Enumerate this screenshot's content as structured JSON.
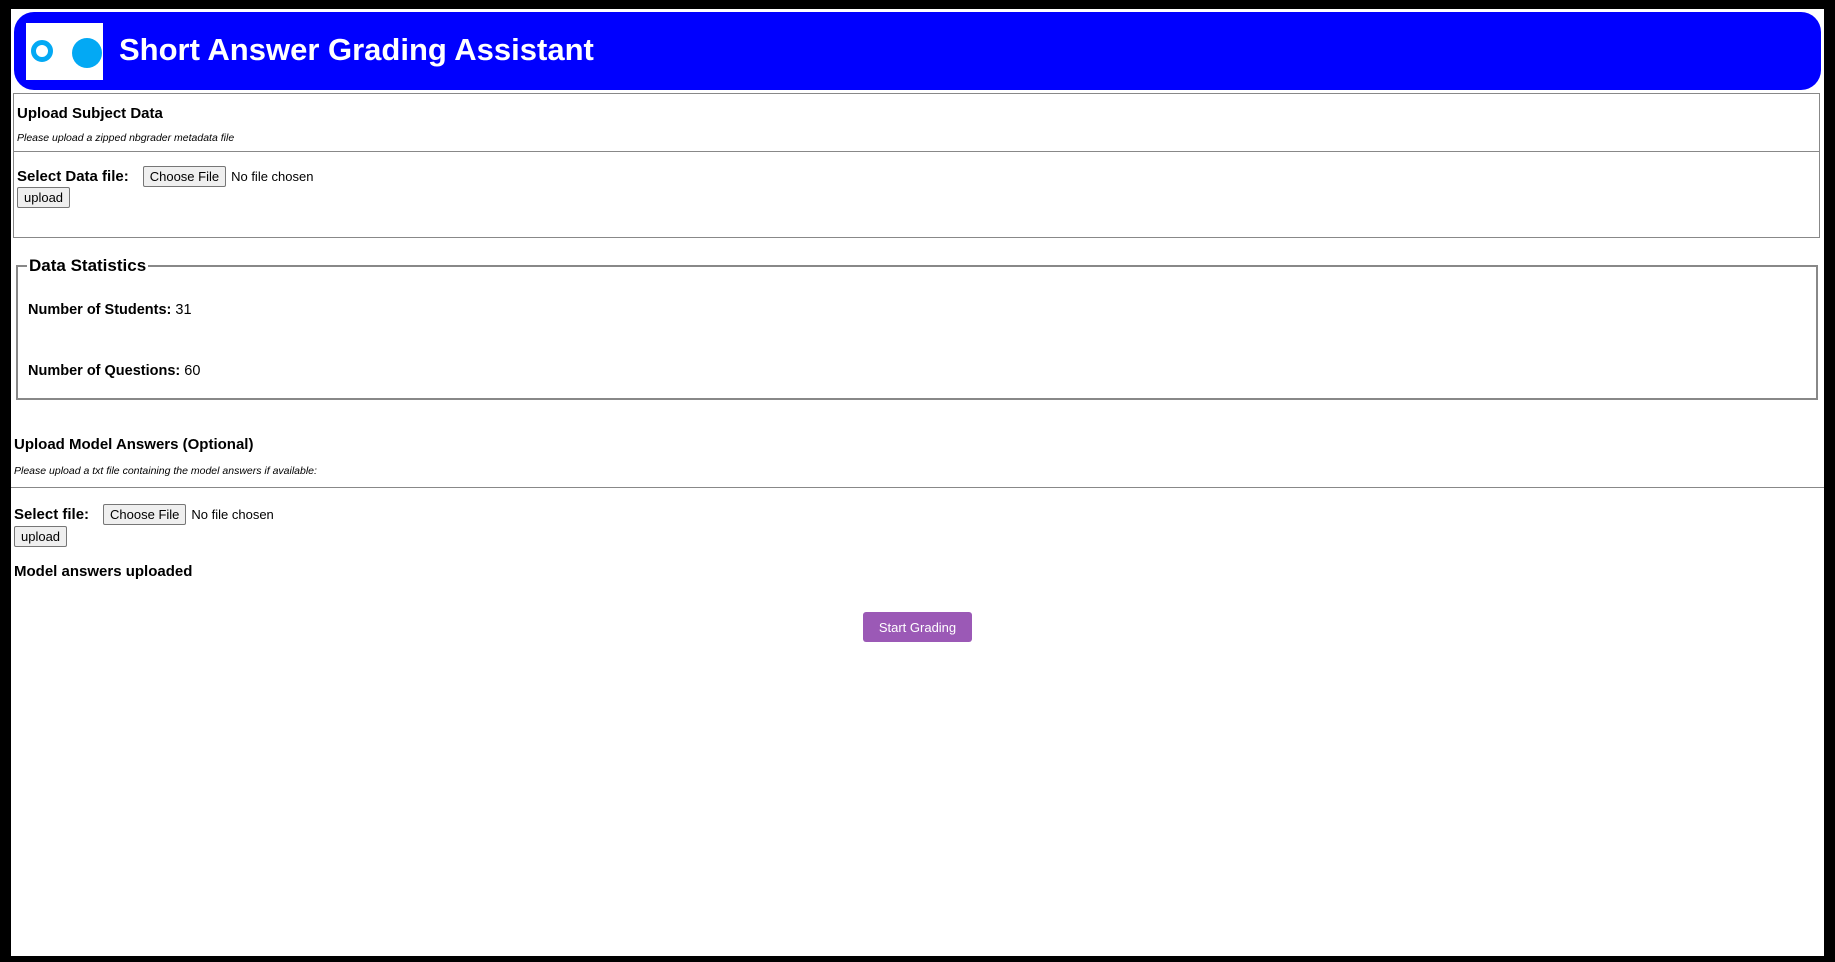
{
  "header": {
    "title": "Short Answer Grading Assistant",
    "logo_icon": "two-circles-logo",
    "background_color": "#0000ff",
    "logo_color": "#03a9f4"
  },
  "subject_upload": {
    "title": "Upload Subject Data",
    "description": "Please upload a zipped nbgrader metadata file",
    "file_label": "Select Data file:",
    "choose_button": "Choose File",
    "file_status": "No file chosen",
    "upload_button": "upload"
  },
  "stats": {
    "legend": "Data Statistics",
    "students_label": "Number of Students:",
    "students_value": "31",
    "questions_label": "Number of Questions:",
    "questions_value": "60"
  },
  "model_upload": {
    "title": "Upload Model Answers (Optional)",
    "description": "Please upload a txt file containing the model answers if available:",
    "file_label": "Select file:",
    "choose_button": "Choose File",
    "file_status": "No file chosen",
    "upload_button": "upload",
    "status_message": "Model answers uploaded"
  },
  "actions": {
    "start_button": "Start Grading",
    "start_button_color": "#9b59b6"
  }
}
